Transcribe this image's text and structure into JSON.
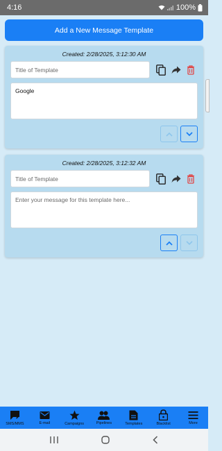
{
  "status_bar": {
    "time": "4:16",
    "battery": "100%"
  },
  "add_button_label": "Add a New Message Template",
  "templates": [
    {
      "created": "Created: 2/28/2025, 3:12:30 AM",
      "title_value": "",
      "title_placeholder": "Title of Template",
      "message_value": "Google",
      "message_placeholder": "Enter your message for this template here...",
      "move_up_enabled": false,
      "move_down_enabled": true
    },
    {
      "created": "Created: 2/28/2025, 3:12:32 AM",
      "title_value": "",
      "title_placeholder": "Title of Template",
      "message_value": "",
      "message_placeholder": "Enter your message for this template here...",
      "move_up_enabled": true,
      "move_down_enabled": false
    }
  ],
  "bottom_nav": [
    {
      "label": "SMS/MMS",
      "icon": "sms-icon"
    },
    {
      "label": "E-mail",
      "icon": "email-icon"
    },
    {
      "label": "Campaigns",
      "icon": "star-icon"
    },
    {
      "label": "Pipelines",
      "icon": "people-icon"
    },
    {
      "label": "Templates",
      "icon": "document-icon"
    },
    {
      "label": "Blacklist",
      "icon": "lock-icon"
    },
    {
      "label": "More",
      "icon": "menu-icon"
    }
  ],
  "colors": {
    "primary": "#1a7ff5",
    "card_bg": "#b7dbef",
    "page_bg": "#d6ebf7",
    "delete_red": "#e04646"
  }
}
